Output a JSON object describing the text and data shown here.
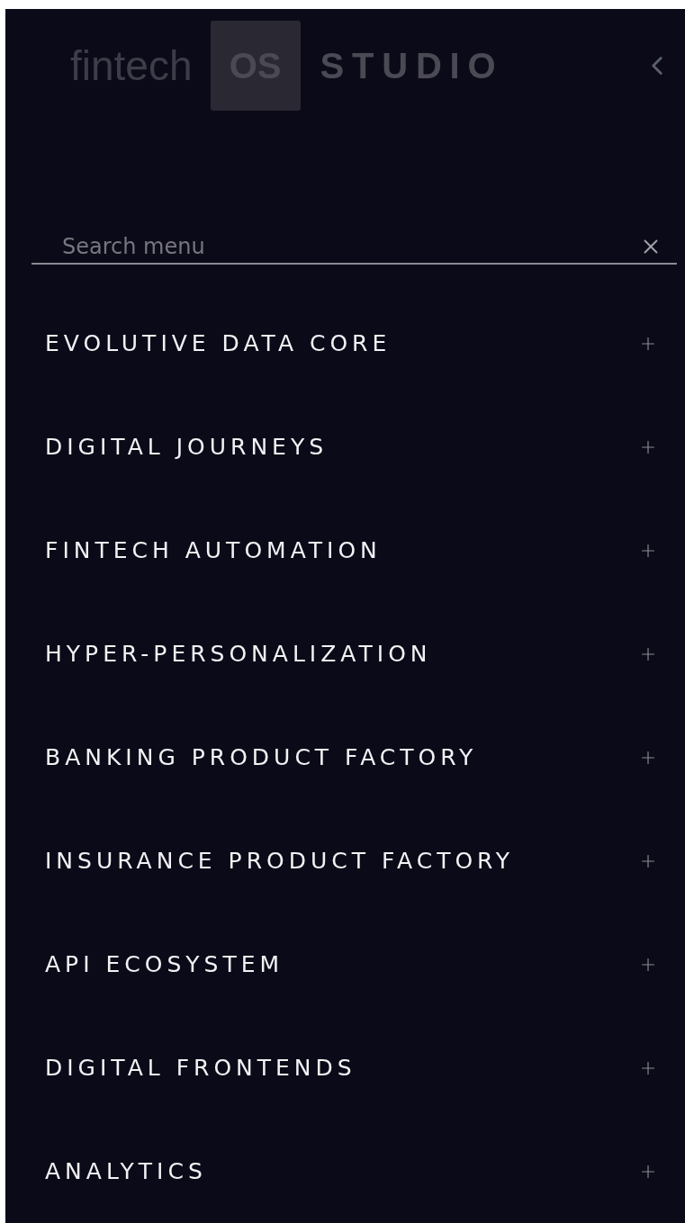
{
  "logo": {
    "word": "fintech",
    "badge": "OS",
    "product": "STUDIO"
  },
  "search": {
    "placeholder": "Search menu"
  },
  "menu": [
    {
      "label": "EVOLUTIVE DATA CORE",
      "expanded": false
    },
    {
      "label": "DIGITAL JOURNEYS",
      "expanded": false
    },
    {
      "label": "FINTECH AUTOMATION",
      "expanded": false
    },
    {
      "label": "HYPER-PERSONALIZATION",
      "expanded": false
    },
    {
      "label": "BANKING PRODUCT FACTORY",
      "expanded": false
    },
    {
      "label": "INSURANCE PRODUCT FACTORY",
      "expanded": false
    },
    {
      "label": "API ECOSYSTEM",
      "expanded": false
    },
    {
      "label": "DIGITAL FRONTENDS",
      "expanded": false
    },
    {
      "label": "ANALYTICS",
      "expanded": false
    }
  ]
}
